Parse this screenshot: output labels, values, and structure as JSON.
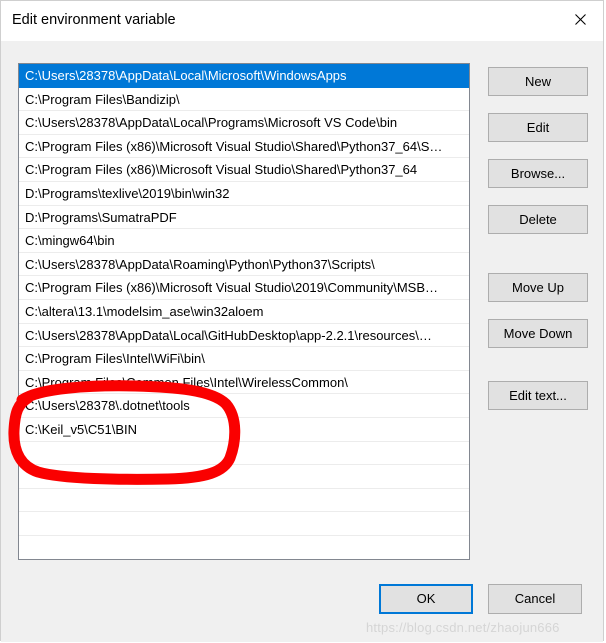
{
  "window": {
    "title": "Edit environment variable",
    "close_icon": "close-icon"
  },
  "list": {
    "selected_index": 0,
    "items": [
      "C:\\Users\\28378\\AppData\\Local\\Microsoft\\WindowsApps",
      "C:\\Program Files\\Bandizip\\",
      "C:\\Users\\28378\\AppData\\Local\\Programs\\Microsoft VS Code\\bin",
      "C:\\Program Files (x86)\\Microsoft Visual Studio\\Shared\\Python37_64\\S…",
      "C:\\Program Files (x86)\\Microsoft Visual Studio\\Shared\\Python37_64",
      "D:\\Programs\\texlive\\2019\\bin\\win32",
      "D:\\Programs\\SumatraPDF",
      "C:\\mingw64\\bin",
      "C:\\Users\\28378\\AppData\\Roaming\\Python\\Python37\\Scripts\\",
      "C:\\Program Files (x86)\\Microsoft Visual Studio\\2019\\Community\\MSB…",
      "C:\\altera\\13.1\\modelsim_ase\\win32aloem",
      "C:\\Users\\28378\\AppData\\Local\\GitHubDesktop\\app-2.2.1\\resources\\…",
      "C:\\Program Files\\Intel\\WiFi\\bin\\",
      "C:\\Program Files\\Common Files\\Intel\\WirelessCommon\\",
      "C:\\Users\\28378\\.dotnet\\tools",
      "C:\\Keil_v5\\C51\\BIN",
      "",
      "",
      "",
      ""
    ]
  },
  "buttons": {
    "new": "New",
    "edit": "Edit",
    "browse": "Browse...",
    "delete": "Delete",
    "move_up": "Move Up",
    "move_down": "Move Down",
    "edit_text": "Edit text...",
    "ok": "OK",
    "cancel": "Cancel"
  },
  "annotation": {
    "color": "#fa0000",
    "shape": "hand-drawn-ellipse",
    "target_item": "C:\\Keil_v5\\C51\\BIN"
  },
  "watermark": {
    "text": "https://blog.csdn.net/zhaojun666"
  },
  "colors": {
    "selection": "#0078d7",
    "dialog_bg": "#f0f0f0",
    "button_face": "#e1e1e1",
    "annotation_red": "#fa0000"
  }
}
